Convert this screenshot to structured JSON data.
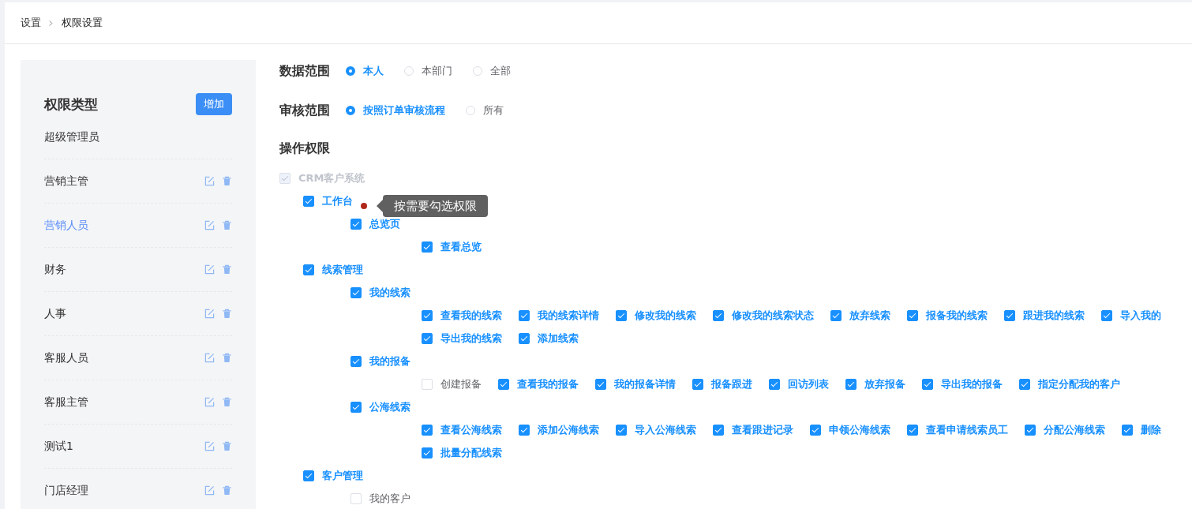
{
  "breadcrumb": [
    {
      "label": "设置",
      "current": false
    },
    {
      "label": "权限设置",
      "current": true
    }
  ],
  "sidebar": {
    "title": "权限类型",
    "add_button": "增加",
    "items": [
      {
        "label": "超级管理员",
        "selected": false,
        "editable": false
      },
      {
        "label": "营销主管",
        "selected": false,
        "editable": true
      },
      {
        "label": "营销人员",
        "selected": true,
        "editable": true
      },
      {
        "label": "财务",
        "selected": false,
        "editable": true
      },
      {
        "label": "人事",
        "selected": false,
        "editable": true
      },
      {
        "label": "客服人员",
        "selected": false,
        "editable": true
      },
      {
        "label": "客服主管",
        "selected": false,
        "editable": true
      },
      {
        "label": "测试1",
        "selected": false,
        "editable": true
      },
      {
        "label": "门店经理",
        "selected": false,
        "editable": true
      }
    ]
  },
  "scopes": [
    {
      "label": "数据范围",
      "options": [
        {
          "label": "本人",
          "selected": true
        },
        {
          "label": "本部门",
          "selected": false
        },
        {
          "label": "全部",
          "selected": false
        }
      ]
    },
    {
      "label": "审核范围",
      "options": [
        {
          "label": "按照订单审核流程",
          "selected": true
        },
        {
          "label": "所有",
          "selected": false
        }
      ]
    }
  ],
  "permissions": {
    "title": "操作权限",
    "tree": [
      {
        "label": "CRM客户系统",
        "checked": true,
        "disabled": true,
        "children": [
          {
            "label": "工作台",
            "checked": true,
            "disabled": false,
            "children": [
              {
                "label": "总览页",
                "checked": true,
                "disabled": false,
                "children": [
                  {
                    "label": "查看总览",
                    "checked": true,
                    "disabled": false
                  }
                ]
              }
            ]
          },
          {
            "label": "线索管理",
            "checked": true,
            "disabled": false,
            "children": [
              {
                "label": "我的线索",
                "checked": true,
                "disabled": false,
                "children": [
                  {
                    "label": "查看我的线索",
                    "checked": true,
                    "disabled": false
                  },
                  {
                    "label": "我的线索详情",
                    "checked": true,
                    "disabled": false
                  },
                  {
                    "label": "修改我的线索",
                    "checked": true,
                    "disabled": false
                  },
                  {
                    "label": "修改我的线索状态",
                    "checked": true,
                    "disabled": false
                  },
                  {
                    "label": "放弃线索",
                    "checked": true,
                    "disabled": false
                  },
                  {
                    "label": "报备我的线索",
                    "checked": true,
                    "disabled": false
                  },
                  {
                    "label": "跟进我的线索",
                    "checked": true,
                    "disabled": false
                  },
                  {
                    "label": "导入我的",
                    "checked": true,
                    "disabled": false
                  },
                  {
                    "label": "导出我的线索",
                    "checked": true,
                    "disabled": false
                  },
                  {
                    "label": "添加线索",
                    "checked": true,
                    "disabled": false
                  }
                ]
              },
              {
                "label": "我的报备",
                "checked": true,
                "disabled": false,
                "children": [
                  {
                    "label": "创建报备",
                    "checked": false,
                    "disabled": false
                  },
                  {
                    "label": "查看我的报备",
                    "checked": true,
                    "disabled": false
                  },
                  {
                    "label": "我的报备详情",
                    "checked": true,
                    "disabled": false
                  },
                  {
                    "label": "报备跟进",
                    "checked": true,
                    "disabled": false
                  },
                  {
                    "label": "回访列表",
                    "checked": true,
                    "disabled": false
                  },
                  {
                    "label": "放弃报备",
                    "checked": true,
                    "disabled": false
                  },
                  {
                    "label": "导出我的报备",
                    "checked": true,
                    "disabled": false
                  },
                  {
                    "label": "指定分配我的客户",
                    "checked": true,
                    "disabled": false
                  }
                ]
              },
              {
                "label": "公海线索",
                "checked": true,
                "disabled": false,
                "children": [
                  {
                    "label": "查看公海线索",
                    "checked": true,
                    "disabled": false
                  },
                  {
                    "label": "添加公海线索",
                    "checked": true,
                    "disabled": false
                  },
                  {
                    "label": "导入公海线索",
                    "checked": true,
                    "disabled": false
                  },
                  {
                    "label": "查看跟进记录",
                    "checked": true,
                    "disabled": false
                  },
                  {
                    "label": "申领公海线索",
                    "checked": true,
                    "disabled": false
                  },
                  {
                    "label": "查看申请线索员工",
                    "checked": true,
                    "disabled": false
                  },
                  {
                    "label": "分配公海线索",
                    "checked": true,
                    "disabled": false
                  },
                  {
                    "label": "删除",
                    "checked": true,
                    "disabled": false
                  },
                  {
                    "label": "批量分配线索",
                    "checked": true,
                    "disabled": false
                  }
                ]
              }
            ]
          },
          {
            "label": "客户管理",
            "checked": true,
            "disabled": false,
            "children": [
              {
                "label": "我的客户",
                "checked": false,
                "disabled": false
              }
            ]
          }
        ]
      }
    ]
  },
  "tooltip": {
    "text": "按需要勾选权限"
  }
}
